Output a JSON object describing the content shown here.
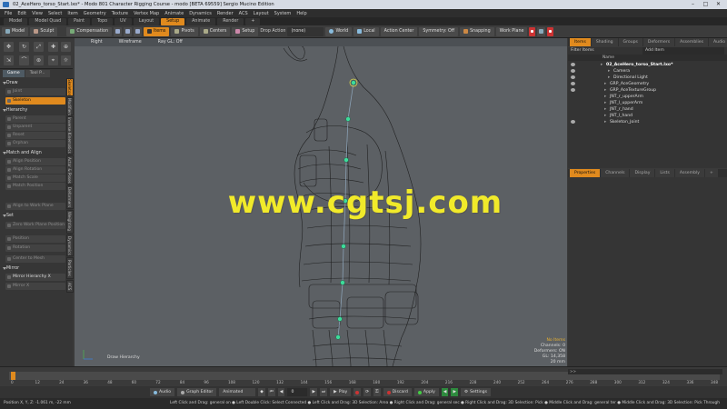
{
  "window": {
    "title": "02_AceHero_torso_Start.lxo* - Modo 801 Character Rigging Course - modo [BETA 69559] Sergio Mucino Edition",
    "minimize": "–",
    "maximize": "□",
    "close": "✕"
  },
  "menu": [
    "File",
    "Edit",
    "View",
    "Select",
    "Item",
    "Geometry",
    "Texture",
    "Vertex Map",
    "Animate",
    "Dynamics",
    "Render",
    "ACS",
    "Layout",
    "System",
    "Help"
  ],
  "layout_tabs": [
    {
      "label": "Model"
    },
    {
      "label": "Model Quad"
    },
    {
      "label": "Paint"
    },
    {
      "label": "Topo"
    },
    {
      "label": "UV"
    },
    {
      "label": "Layout"
    },
    {
      "label": "Setup",
      "active": true
    },
    {
      "label": "Animate"
    },
    {
      "label": "Render"
    },
    {
      "label": "+"
    }
  ],
  "toolbar": {
    "model": "Model",
    "sculpt": "Sculpt",
    "compensation": "Compensation",
    "items": "Items",
    "pivots": "Pivots",
    "centers": "Centers",
    "setup": "Setup",
    "drop_action_label": "Drop Action",
    "drop_action_value": "(none)",
    "world": "World",
    "local": "Local",
    "action_center": "Action Center",
    "symmetry": "Symmetry: Off",
    "snapping": "Snapping",
    "work_plane": "Work Plane"
  },
  "left_panel": {
    "tabs": [
      "Game",
      "Tool P..."
    ],
    "vertical_tabs": [
      "Skeleton",
      "Modifiers",
      "Inverse Kinematics",
      "Actor & Poses",
      "Deformers",
      "Weighting",
      "Dynamics",
      "Particles",
      "ACS"
    ],
    "sections": [
      {
        "title": "Draw",
        "rows": [
          {
            "label": "Joint",
            "state": "dim"
          },
          {
            "label": "Skeleton",
            "state": "active"
          }
        ]
      },
      {
        "title": "Hierarchy",
        "rows": [
          {
            "label": "Parent",
            "state": "dim"
          },
          {
            "label": "Unparent",
            "state": "dim"
          },
          {
            "label": "Reset",
            "state": "dim"
          },
          {
            "label": "Orphan",
            "state": "dim"
          }
        ]
      },
      {
        "title": "Match and Align",
        "rows": [
          {
            "label": "Align Position",
            "state": "dim"
          },
          {
            "label": "Align Rotation",
            "state": "dim"
          },
          {
            "label": "Match Scale",
            "state": "dim"
          },
          {
            "label": "Match Position",
            "state": "dim"
          },
          {
            "label": "Align to Work Plane",
            "state": "dim"
          }
        ]
      },
      {
        "title": "Set",
        "rows": [
          {
            "label": "Zero Work Plane Position",
            "state": "dim"
          },
          {
            "label": "Position",
            "state": "dim"
          },
          {
            "label": "Rotation",
            "state": "dim"
          },
          {
            "label": "Center to Mesh",
            "state": "dim"
          }
        ]
      },
      {
        "title": "Mirror",
        "rows": [
          {
            "label": "Mirror Hierarchy X",
            "state": "bright"
          },
          {
            "label": "Mirror X",
            "state": "dim"
          }
        ]
      }
    ]
  },
  "viewport": {
    "header": [
      "Right",
      "Wireframe",
      "Ray GL: Off"
    ],
    "watermark": "www.cgtsj.com",
    "stats": [
      "No Items",
      "Channels: 0",
      "Deformers: ON",
      "GL: 14,358",
      "20 mm"
    ],
    "draw_label": "Draw Hierarchy"
  },
  "right_panel": {
    "top_tabs": [
      {
        "label": "Items",
        "active": true
      },
      {
        "label": "Shading"
      },
      {
        "label": "Groups"
      },
      {
        "label": "Deformers"
      },
      {
        "label": "Assemblies"
      },
      {
        "label": "Audio"
      }
    ],
    "filter_label": "Filter Items",
    "add_item": "Add Item",
    "name_header": "Name",
    "items": [
      {
        "label": "02_AceHero_torso_Start.lxo*",
        "indent": 0,
        "eye": true,
        "root": true
      },
      {
        "label": "Camera",
        "indent": 2,
        "eye": true
      },
      {
        "label": "Directional Light",
        "indent": 2,
        "eye": true
      },
      {
        "label": "GRP_AceGeometry",
        "indent": 1,
        "eye": true
      },
      {
        "label": "GRP_AceTextureGroup",
        "indent": 1,
        "eye": true
      },
      {
        "label": "JNT_r_upperArm",
        "indent": 1,
        "eye": false
      },
      {
        "label": "JNT_l_upperArm",
        "indent": 1,
        "eye": false
      },
      {
        "label": "JNT_r_hand",
        "indent": 1,
        "eye": false
      },
      {
        "label": "JNT_l_hand",
        "indent": 1,
        "eye": false
      },
      {
        "label": "Skeleton_Joint",
        "indent": 1,
        "eye": true
      }
    ],
    "bottom_tabs": [
      {
        "label": "Properties",
        "active": true
      },
      {
        "label": "Channels"
      },
      {
        "label": "Display"
      },
      {
        "label": "Lists"
      },
      {
        "label": "Assembly"
      },
      {
        "label": "+"
      }
    ]
  },
  "timeline": {
    "ticks": [
      "0",
      "12",
      "24",
      "36",
      "48",
      "60",
      "72",
      "84",
      "96",
      "108",
      "120",
      "132",
      "144",
      "156",
      "168",
      "180",
      "192",
      "204",
      "216",
      "228",
      "240",
      "252",
      "264",
      "276",
      "288",
      "300",
      "312",
      "324",
      "336",
      "348"
    ],
    "current_frame": 0,
    "right_field": ">>"
  },
  "bottom_bar": {
    "audio": "Audio",
    "graph_editor": "Graph Editor",
    "animated": "Animated",
    "frame": "0",
    "play": "Play",
    "discard": "Discard",
    "apply": "Apply",
    "settings": "Settings"
  },
  "status": {
    "position": "Position X, Y, Z:  -1.061 m,  -22 mm",
    "hints": "Left Click and Drag: general  on  ● Left Double Click: Select Connected  ● Left Click and Drag: 3D Selection: Area  ● Right Click and Drag: general  sec  ● Right Click and Drag: 3D Selection: Pick  ● Middle Click and Drag: general  ter  ● Middle Click and Drag: 3D Selection: Pick Through"
  },
  "colors": {
    "accent": "#e08a1e",
    "viewport_bg": "#5c6064",
    "joint": "#3ddc9a",
    "watermark": "#f1ea2a"
  }
}
